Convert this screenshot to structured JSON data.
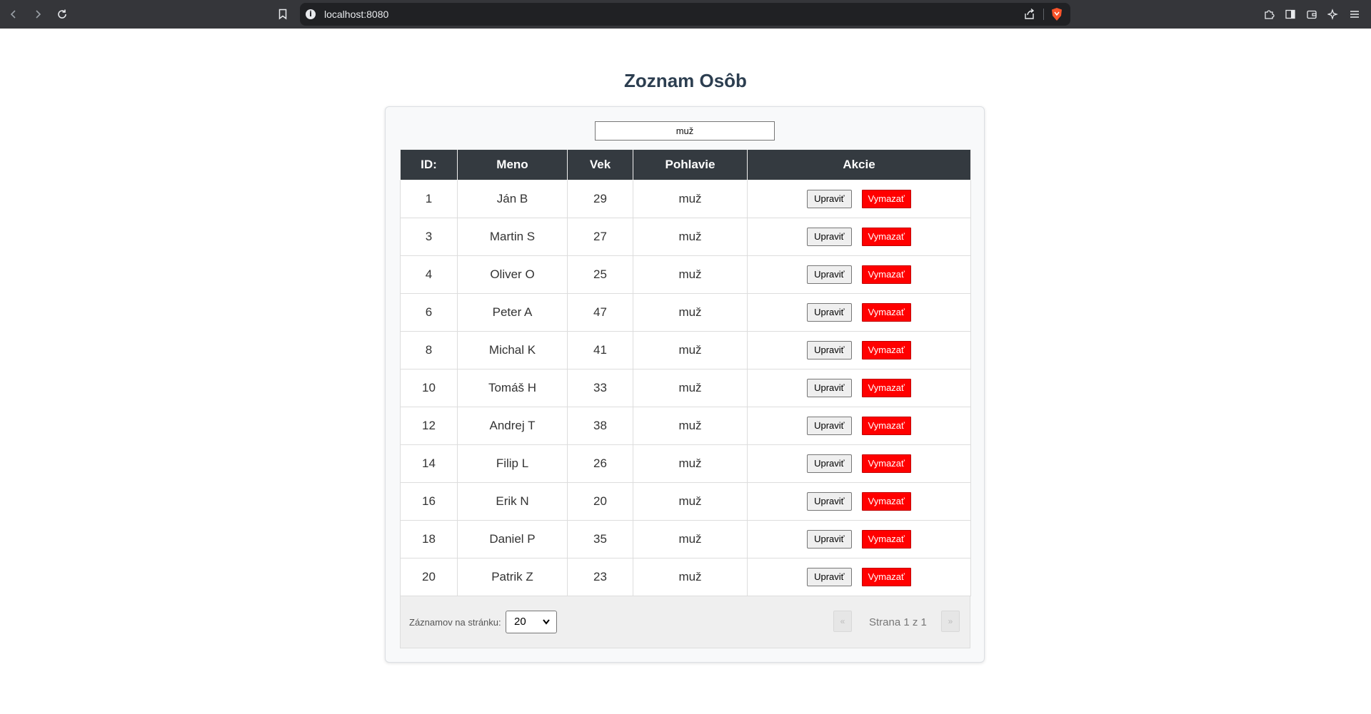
{
  "browser": {
    "url": "localhost:8080"
  },
  "page": {
    "title": "Zoznam Osôb"
  },
  "filter": {
    "value": "muž"
  },
  "table": {
    "headers": [
      "ID:",
      "Meno",
      "Vek",
      "Pohlavie",
      "Akcie"
    ],
    "edit_label": "Upraviť",
    "delete_label": "Vymazať",
    "rows": [
      {
        "id": "1",
        "name": "Ján B",
        "age": "29",
        "gender": "muž"
      },
      {
        "id": "3",
        "name": "Martin S",
        "age": "27",
        "gender": "muž"
      },
      {
        "id": "4",
        "name": "Oliver O",
        "age": "25",
        "gender": "muž"
      },
      {
        "id": "6",
        "name": "Peter A",
        "age": "47",
        "gender": "muž"
      },
      {
        "id": "8",
        "name": "Michal K",
        "age": "41",
        "gender": "muž"
      },
      {
        "id": "10",
        "name": "Tomáš H",
        "age": "33",
        "gender": "muž"
      },
      {
        "id": "12",
        "name": "Andrej T",
        "age": "38",
        "gender": "muž"
      },
      {
        "id": "14",
        "name": "Filip L",
        "age": "26",
        "gender": "muž"
      },
      {
        "id": "16",
        "name": "Erik N",
        "age": "20",
        "gender": "muž"
      },
      {
        "id": "18",
        "name": "Daniel P",
        "age": "35",
        "gender": "muž"
      },
      {
        "id": "20",
        "name": "Patrik Z",
        "age": "23",
        "gender": "muž"
      }
    ]
  },
  "pagination": {
    "per_page_label": "Záznamov na stránku:",
    "per_page_value": "20",
    "prev_label": "«",
    "next_label": "»",
    "page_info": "Strana 1 z 1"
  },
  "colors": {
    "header_bg": "#343a40",
    "delete_bg": "#ff0000",
    "title_color": "#2c3e50"
  }
}
